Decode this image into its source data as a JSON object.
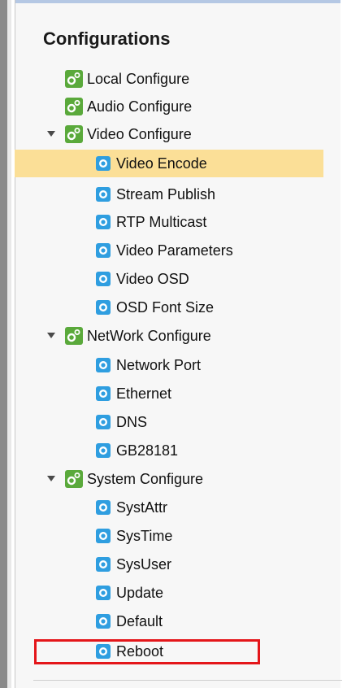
{
  "title": "Configurations",
  "tree": {
    "local": "Local Configure",
    "audio": "Audio Configure",
    "video": {
      "label": "Video Configure",
      "children": [
        "Video Encode",
        "Stream Publish",
        "RTP Multicast",
        "Video Parameters",
        "Video OSD",
        "OSD Font Size"
      ]
    },
    "network": {
      "label": "NetWork Configure",
      "children": [
        "Network Port",
        "Ethernet",
        "DNS",
        "GB28181"
      ]
    },
    "system": {
      "label": "System Configure",
      "children": [
        "SystAttr",
        "SysTime",
        "SysUser",
        "Update",
        "Default",
        "Reboot"
      ]
    }
  },
  "selected_item": "Video Encode",
  "highlighted_item": "Reboot",
  "colors": {
    "selection": "#fbdf97",
    "highlight_box": "#e4161a",
    "group_icon": "#5aa93b",
    "leaf_icon": "#2f9ee0"
  },
  "icons": {
    "group": "gears-icon",
    "leaf": "gear-icon",
    "expander": "expand-arrow-icon"
  }
}
